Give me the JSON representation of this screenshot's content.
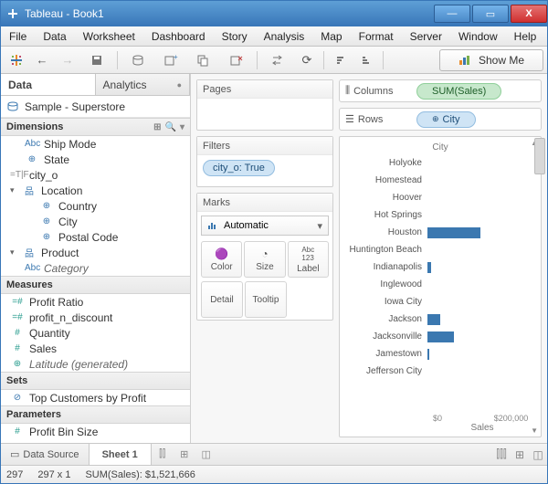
{
  "title": "Tableau - Book1",
  "menu": [
    "File",
    "Data",
    "Worksheet",
    "Dashboard",
    "Story",
    "Analysis",
    "Map",
    "Format",
    "Server",
    "Window",
    "Help"
  ],
  "showme_label": "Show Me",
  "sidepane": {
    "tabs": {
      "data": "Data",
      "analytics": "Analytics"
    },
    "datasource": "Sample - Superstore",
    "dimensions_head": "Dimensions",
    "dims": [
      {
        "icon": "Abc",
        "label": "Ship Mode",
        "indent": 1
      },
      {
        "icon": "⊕",
        "label": "State",
        "indent": 1
      },
      {
        "icon": "=T|F",
        "label": "city_o",
        "indent": 0,
        "iconc": "gray"
      },
      {
        "icon": "品",
        "label": "Location",
        "indent": 0,
        "arrow": "▾"
      },
      {
        "icon": "⊕",
        "label": "Country",
        "indent": 2
      },
      {
        "icon": "⊕",
        "label": "City",
        "indent": 2
      },
      {
        "icon": "⊕",
        "label": "Postal Code",
        "indent": 2
      },
      {
        "icon": "品",
        "label": "Product",
        "indent": 0,
        "arrow": "▾"
      },
      {
        "icon": "Abc",
        "label": "Category",
        "indent": 1,
        "ital": true
      }
    ],
    "measures_head": "Measures",
    "meas": [
      {
        "icon": "=#",
        "label": "Profit Ratio"
      },
      {
        "icon": "=#",
        "label": "profit_n_discount"
      },
      {
        "icon": "#",
        "label": "Quantity"
      },
      {
        "icon": "#",
        "label": "Sales"
      },
      {
        "icon": "⊕",
        "label": "Latitude (generated)",
        "ital": true
      }
    ],
    "sets_head": "Sets",
    "sets": [
      {
        "icon": "⊘",
        "label": "Top Customers by Profit"
      }
    ],
    "params_head": "Parameters",
    "params": [
      {
        "icon": "#",
        "label": "Profit Bin Size"
      }
    ]
  },
  "shelves": {
    "pages": "Pages",
    "filters": "Filters",
    "marks": "Marks",
    "columns": "Columns",
    "rows": "Rows",
    "col_pill": "SUM(Sales)",
    "row_pill": "City",
    "filter_pill": "city_o: True",
    "marks_drop": "Automatic",
    "mark_color": "Color",
    "mark_size": "Size",
    "mark_label": "Label",
    "mark_detail": "Detail",
    "mark_tooltip": "Tooltip"
  },
  "chart_data": {
    "type": "bar",
    "title": "City",
    "xlabel": "Sales",
    "xlim": [
      0,
      250000
    ],
    "ticks": [
      "$0",
      "$200,000"
    ],
    "categories": [
      "Holyoke",
      "Homestead",
      "Hoover",
      "Hot Springs",
      "Houston",
      "Huntington Beach",
      "Indianapolis",
      "Inglewood",
      "Iowa City",
      "Jackson",
      "Jacksonville",
      "Jamestown",
      "Jefferson City"
    ],
    "values": [
      0,
      0,
      0,
      0,
      120000,
      0,
      8000,
      0,
      0,
      30000,
      60000,
      4000,
      0
    ]
  },
  "tabs": {
    "datasource": "Data Source",
    "sheet": "Sheet 1"
  },
  "status": {
    "marks": "297",
    "sel": "297 x 1",
    "agg": "SUM(Sales): $1,521,666"
  }
}
